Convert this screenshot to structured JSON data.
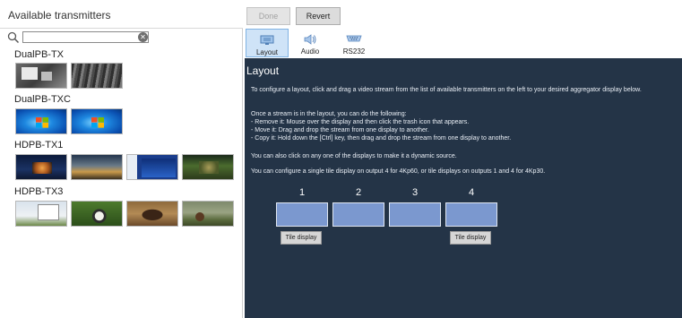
{
  "left_panel": {
    "title": "Available transmitters",
    "search": {
      "value": "",
      "placeholder": ""
    },
    "groups": [
      {
        "name": "DualPB-TX",
        "thumbs": 2
      },
      {
        "name": "DualPB-TXC",
        "thumbs": 2
      },
      {
        "name": "HDPB-TX1",
        "thumbs": 4
      },
      {
        "name": "HDPB-TX3",
        "thumbs": 4
      }
    ]
  },
  "toolbar": {
    "done_label": "Done",
    "revert_label": "Revert"
  },
  "tabs": [
    {
      "label": "Layout",
      "icon": "monitor-icon",
      "active": true
    },
    {
      "label": "Audio",
      "icon": "speaker-icon",
      "active": false
    },
    {
      "label": "RS232",
      "icon": "serial-port-icon",
      "active": false
    }
  ],
  "main": {
    "heading": "Layout",
    "intro": "To configure a layout, click and drag a video stream from the list of available transmitters on the left to your desired aggregator display below.",
    "once_title": "Once a stream is in the layout, you can do the following:",
    "actions": [
      " - Remove it: Mouse over the display and then click the trash icon that appears.",
      " - Move it: Drag and drop the stream from one display to another.",
      " - Copy it: Hold down the [Ctrl] key, then drag and drop the stream from one display to another."
    ],
    "dynamic_note": "You can also click on any one of the displays to make it a dynamic source.",
    "tile_note": "You can configure a single tile display on output 4 for 4Kp60, or tile displays on outputs 1 and 4 for 4Kp30.",
    "displays": [
      "1",
      "2",
      "3",
      "4"
    ],
    "tile_button_label": "Tile display"
  },
  "colors": {
    "main_bg": "#243447",
    "display_fill": "#7b98cf",
    "active_tab": "#cfe3f7"
  }
}
